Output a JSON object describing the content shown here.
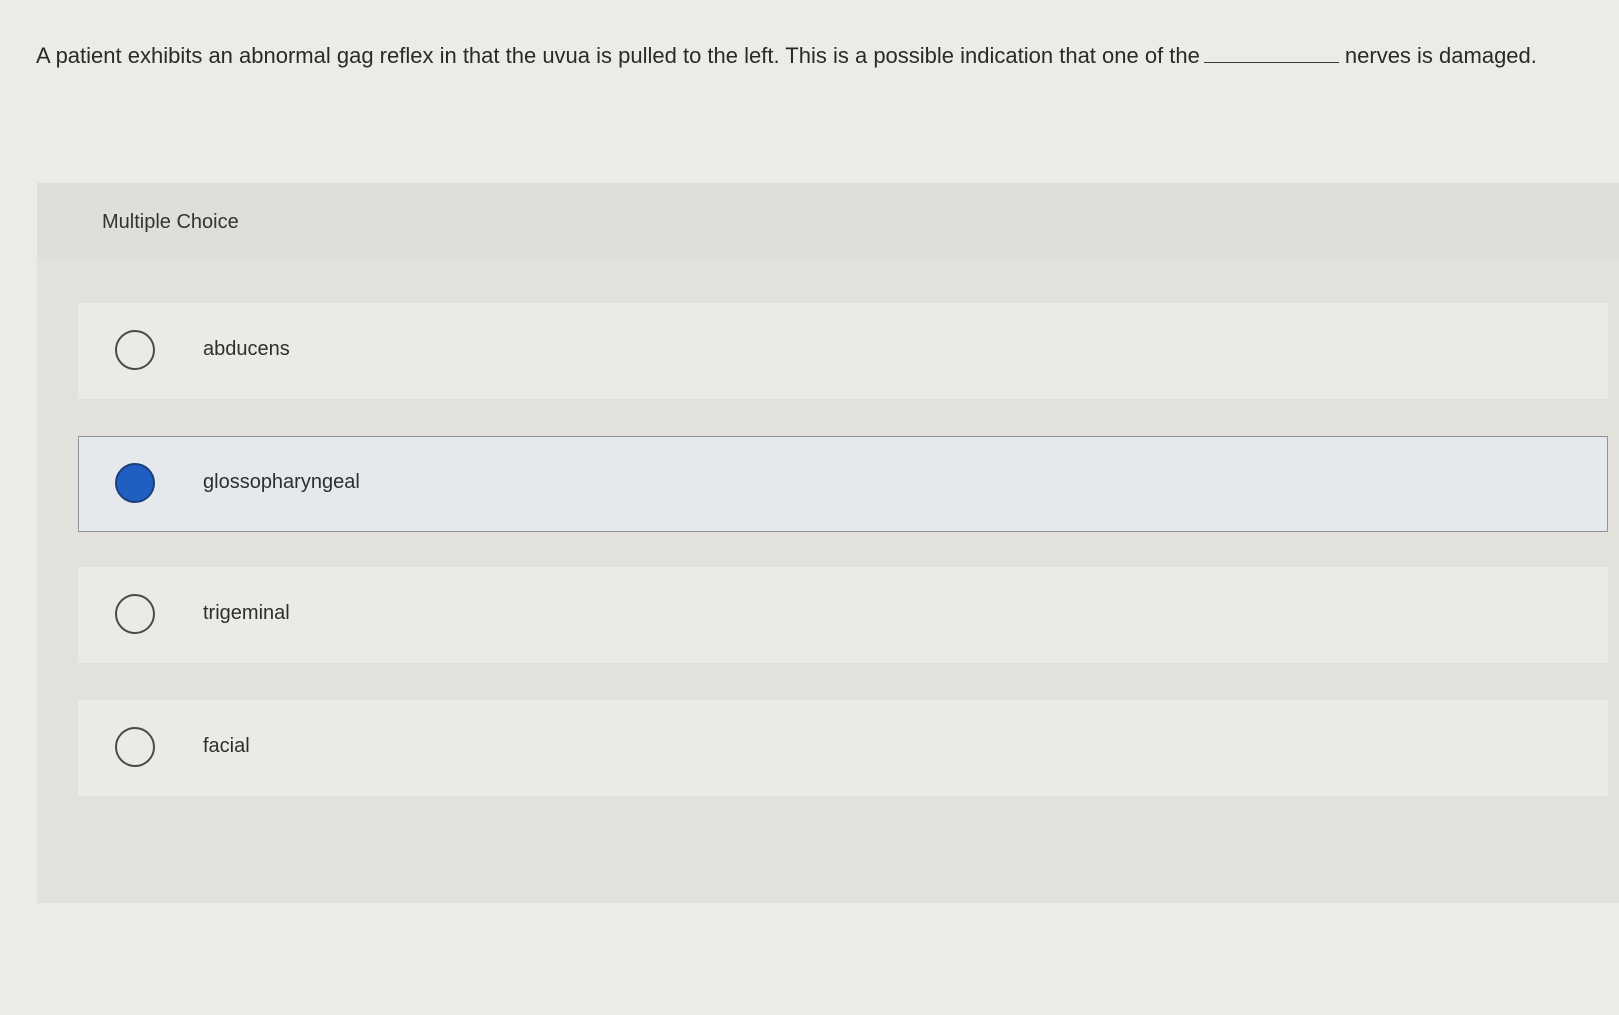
{
  "question": {
    "text_before": "A patient exhibits an abnormal gag reflex in that the uvua is pulled to the left. This is a possible indication that one of the",
    "text_after": "nerves is damaged."
  },
  "multiple_choice": {
    "label": "Multiple Choice",
    "options": [
      {
        "label": "abducens",
        "selected": false
      },
      {
        "label": "glossopharyngeal",
        "selected": true
      },
      {
        "label": "trigeminal",
        "selected": false
      },
      {
        "label": "facial",
        "selected": false
      }
    ]
  },
  "colors": {
    "selected_radio": "#1f5fc2",
    "selected_border": "#8e9299",
    "background": "#ecebe7"
  }
}
